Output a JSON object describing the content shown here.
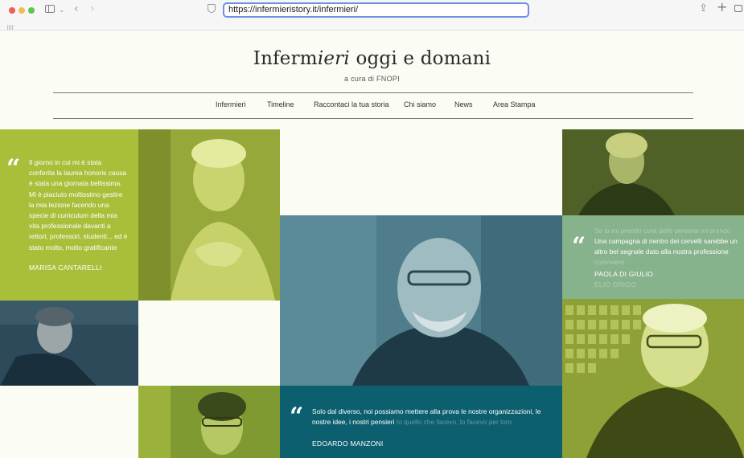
{
  "browser": {
    "url": "https://infermieristory.it/infermieri/"
  },
  "site": {
    "title_prefix": "Inferm",
    "title_italic": "ieri",
    "title_suffix": " oggi e domani",
    "subtitle": "a cura di FNOPI"
  },
  "nav": [
    "Infermieri",
    "Timeline",
    "Raccontaci la tua storia",
    "Chi siamo",
    "News",
    "Area Stampa"
  ],
  "quotes": {
    "marisa": {
      "text": "Il giorno in cui mi è stata conferita la laurea honoris causa è stata una giornata bellissima. Mi è piaciuto moltissimo gestire la mia lezione facendo una specie di curriculum della mia vita professionale davanti a rettori, professori, studenti... ed è stato molto, molto gratificante",
      "name": "MARISA CANTARELLI"
    },
    "paola": {
      "ghost_top": "Se la mi prendo cura delle persone mi prendo",
      "text": "Una campagna di rientro dei cervelli sarebbe un altro bel segnale dato alla nostra professione",
      "ghost_mid": "conviviere",
      "name": "PAOLA DI GIULIO",
      "ghost_name": "ELIO DRIGO"
    },
    "edoardo": {
      "text": "Solo dal diverso, noi possiamo mettere alla prova le nostre organizzazioni, le nostre idee, i nostri pensieri",
      "ghost": "Io quello che facevo, lo facevo per loro",
      "name": "EDOARDO MANZONI"
    }
  },
  "colors": {
    "lime": "#a9bf3a",
    "teal": "#0c5f6e",
    "sage": "#86b28c",
    "page_bg": "#fbfcf4"
  }
}
